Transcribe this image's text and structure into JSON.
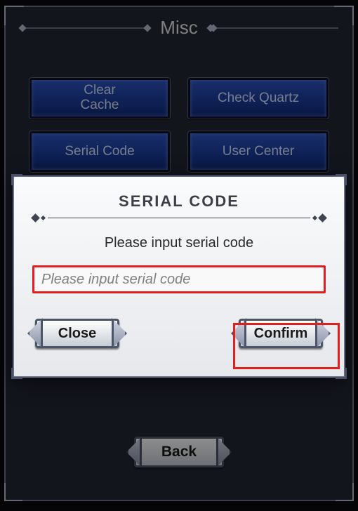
{
  "header": {
    "title": "Misc"
  },
  "buttons": {
    "clear_cache": "Clear\nCache",
    "check_quartz": "Check Quartz",
    "serial_code": "Serial Code",
    "user_center": "User Center"
  },
  "back_label": "Back",
  "dialog": {
    "title": "Serial Code",
    "message": "Please input serial code",
    "input_placeholder": "Please input serial code",
    "close_label": "Close",
    "confirm_label": "Confirm"
  },
  "highlight": {
    "confirm_box": true,
    "input_box": true
  },
  "colors": {
    "accent_red": "#e02020",
    "button_blue": "#1c3d9e"
  }
}
